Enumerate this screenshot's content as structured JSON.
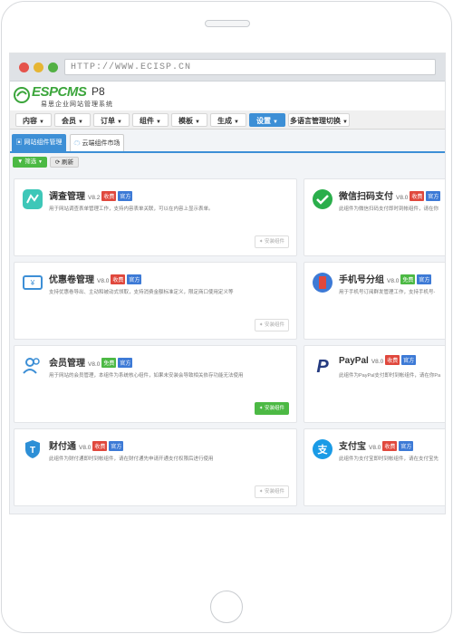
{
  "browser": {
    "url": "HTTP://WWW.ECISP.CN"
  },
  "logo": {
    "brand": "ESPCMS",
    "version": "P8",
    "subtitle": "易思企业网站管理系统"
  },
  "nav": [
    {
      "label": "内容"
    },
    {
      "label": "会员"
    },
    {
      "label": "订单"
    },
    {
      "label": "组件"
    },
    {
      "label": "模板"
    },
    {
      "label": "生成"
    },
    {
      "label": "设置"
    },
    {
      "label": "多语言管理切换"
    }
  ],
  "tabs": [
    {
      "label": "网站组件管理"
    },
    {
      "label": "云端组件市场"
    }
  ],
  "toolbar": {
    "filter_label": "筛选",
    "refresh_label": "刷新"
  },
  "badge_labels": {
    "paid": "收费",
    "free": "免费",
    "official": "官方"
  },
  "install_label": "安装组件",
  "plugins": [
    {
      "name": "调查管理",
      "version": "V8.2",
      "price": "收费",
      "official": "官方",
      "description": "用于网站调查表单管理工作，支持内容表单关联，可以在内容上显示表单。",
      "icon": "survey-icon",
      "installable": false
    },
    {
      "name": "微信扫码支付",
      "version": "V8.0",
      "price": "收费",
      "official": "官方",
      "description": "此组件为微信扫码支付即时到帐组件，请在你",
      "icon": "wechat-pay-icon"
    },
    {
      "name": "优惠卷管理",
      "version": "V8.0",
      "price": "收费",
      "official": "官方",
      "description": "支持优惠卷导出、主动和被动式领取，支持消费金额标准定义，限定商口使用定义等",
      "icon": "coupon-icon",
      "installable": false
    },
    {
      "name": "手机号分组",
      "version": "V8.0",
      "price": "免费",
      "official": "官方",
      "description": "用于手机号订阅群发管理工作，支持手机号-",
      "icon": "phone-group-icon"
    },
    {
      "name": "会员管理",
      "version": "V8.0",
      "price": "免费",
      "official": "官方",
      "description": "用于网站的会员管理，本组件为系统核心组件，如果未安装会导致相关依存功能无法使用",
      "icon": "members-icon",
      "installable": true
    },
    {
      "name": "PayPal",
      "version": "V8.0",
      "price": "收费",
      "official": "官方",
      "description": "此组件为PayPal支付即时到帐组件，请在你Pa",
      "icon": "paypal-icon"
    },
    {
      "name": "财付通",
      "version": "V8.0",
      "price": "收费",
      "official": "官方",
      "description": "此组件为财付通即时到帐组件，请在财付通先申请开通支付权限后进行使用",
      "icon": "tenpay-icon",
      "installable": false
    },
    {
      "name": "支付宝",
      "version": "V8.0",
      "price": "收费",
      "official": "官方",
      "description": "此组件为支付宝即时到帐组件，请在支付宝先",
      "icon": "alipay-icon"
    }
  ]
}
